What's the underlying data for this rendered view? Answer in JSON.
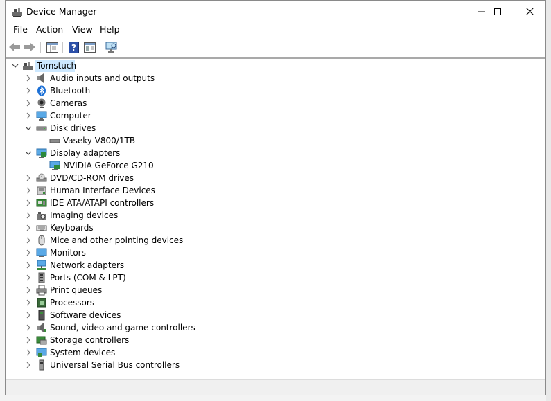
{
  "window": {
    "title": "Device Manager"
  },
  "menu": [
    "File",
    "Action",
    "View",
    "Help"
  ],
  "tree": {
    "root": "Tomstuch",
    "items": [
      {
        "label": "Audio inputs and outputs",
        "icon": "speaker-icon",
        "expanded": false
      },
      {
        "label": "Bluetooth",
        "icon": "bluetooth-icon",
        "expanded": false
      },
      {
        "label": "Cameras",
        "icon": "camera-icon",
        "expanded": false
      },
      {
        "label": "Computer",
        "icon": "computer-icon",
        "expanded": false
      },
      {
        "label": "Disk drives",
        "icon": "disk-drive-icon",
        "expanded": true,
        "children": [
          "Vaseky V800/1TB"
        ]
      },
      {
        "label": "Display adapters",
        "icon": "display-adapter-icon",
        "expanded": true,
        "children": [
          "NVIDIA GeForce G210"
        ]
      },
      {
        "label": "DVD/CD-ROM drives",
        "icon": "dvd-drive-icon",
        "expanded": false
      },
      {
        "label": "Human Interface Devices",
        "icon": "hid-icon",
        "expanded": false
      },
      {
        "label": "IDE ATA/ATAPI controllers",
        "icon": "ide-controller-icon",
        "expanded": false
      },
      {
        "label": "Imaging devices",
        "icon": "imaging-icon",
        "expanded": false
      },
      {
        "label": "Keyboards",
        "icon": "keyboard-icon",
        "expanded": false
      },
      {
        "label": "Mice and other pointing devices",
        "icon": "mouse-icon",
        "expanded": false
      },
      {
        "label": "Monitors",
        "icon": "monitor-icon",
        "expanded": false
      },
      {
        "label": "Network adapters",
        "icon": "network-adapter-icon",
        "expanded": false
      },
      {
        "label": "Ports (COM & LPT)",
        "icon": "port-icon",
        "expanded": false
      },
      {
        "label": "Print queues",
        "icon": "printer-icon",
        "expanded": false
      },
      {
        "label": "Processors",
        "icon": "processor-icon",
        "expanded": false
      },
      {
        "label": "Software devices",
        "icon": "software-device-icon",
        "expanded": false
      },
      {
        "label": "Sound, video and game controllers",
        "icon": "sound-icon",
        "expanded": false
      },
      {
        "label": "Storage controllers",
        "icon": "storage-controller-icon",
        "expanded": false
      },
      {
        "label": "System devices",
        "icon": "system-device-icon",
        "expanded": false
      },
      {
        "label": "Universal Serial Bus controllers",
        "icon": "usb-icon",
        "expanded": false
      }
    ]
  },
  "colors": {
    "selection": "#cce8ff",
    "accent": "#0078d7"
  }
}
